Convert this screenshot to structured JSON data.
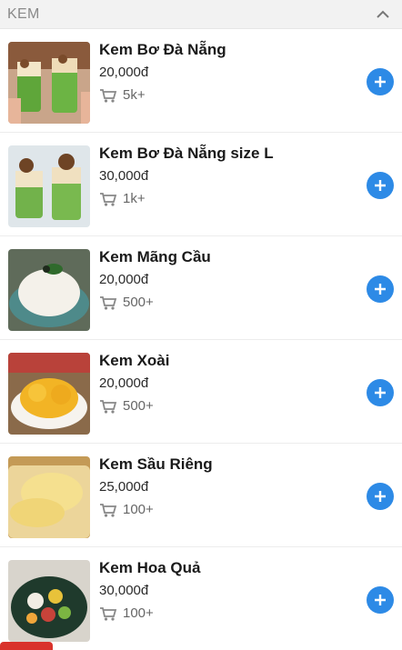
{
  "section": {
    "title": "KEM",
    "collapse_icon": "chevron-up-icon"
  },
  "colors": {
    "accent": "#2d8ae6",
    "header_bg": "#f2f2f2",
    "bottom_tab": "#d9322b"
  },
  "items": [
    {
      "name": "Kem Bơ Đà Nẵng",
      "price": "20,000đ",
      "sold": "5k+"
    },
    {
      "name": "Kem Bơ Đà Nẵng size L",
      "price": "30,000đ",
      "sold": "1k+"
    },
    {
      "name": "Kem Mãng Cầu",
      "price": "20,000đ",
      "sold": "500+"
    },
    {
      "name": "Kem Xoài",
      "price": "20,000đ",
      "sold": "500+"
    },
    {
      "name": "Kem Sầu Riêng",
      "price": "25,000đ",
      "sold": "100+"
    },
    {
      "name": "Kem Hoa Quả",
      "price": "30,000đ",
      "sold": "100+"
    }
  ]
}
